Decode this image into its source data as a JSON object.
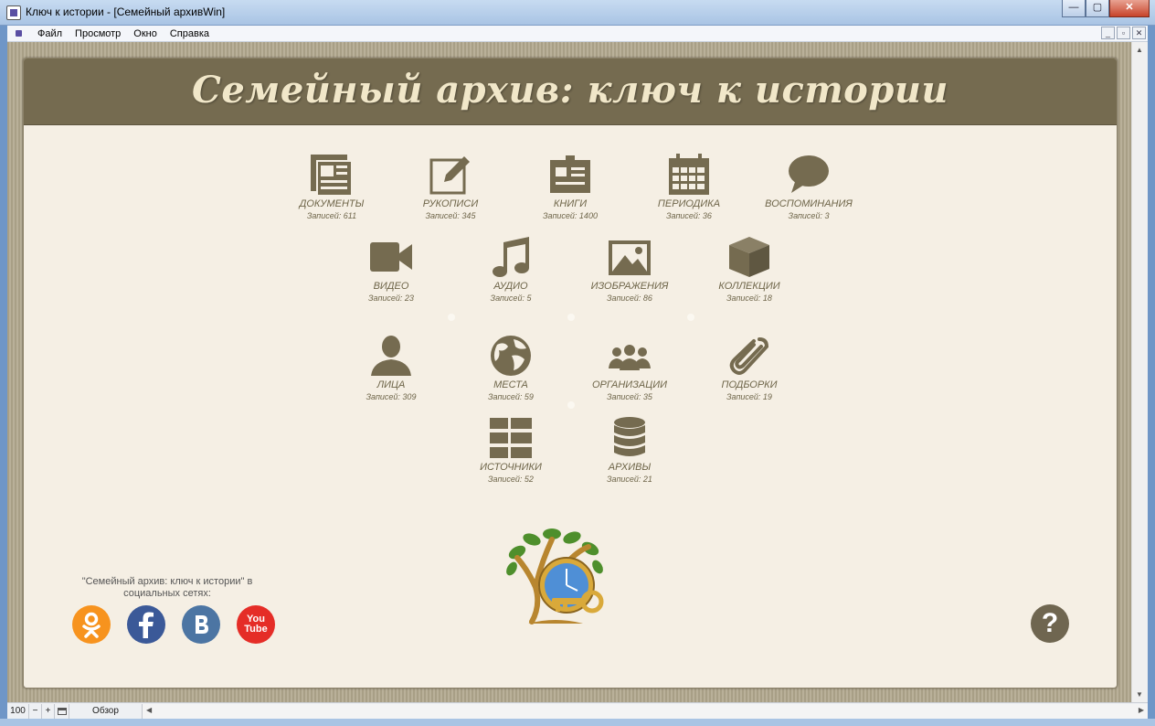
{
  "window": {
    "title": "Ключ к истории - [Семейный архивWin]",
    "minimize": "—",
    "maximize": "▢",
    "close": "✕"
  },
  "menu": {
    "items": [
      "Файл",
      "Просмотр",
      "Окно",
      "Справка"
    ],
    "mdi_minimize": "_",
    "mdi_restore": "▫",
    "mdi_close": "✕"
  },
  "header": {
    "title": "Семейный архив: ключ к истории"
  },
  "tiles": [
    {
      "label": "ДОКУМЕНТЫ",
      "count": "Записей: 611",
      "icon": "documents-icon"
    },
    {
      "label": "РУКОПИСИ",
      "count": "Записей: 345",
      "icon": "manuscripts-icon"
    },
    {
      "label": "КНИГИ",
      "count": "Записей: 1400",
      "icon": "books-icon"
    },
    {
      "label": "ПЕРИОДИКА",
      "count": "Записей: 36",
      "icon": "calendar-icon"
    },
    {
      "label": "ВОСПОМИНАНИЯ",
      "count": "Записей: 3",
      "icon": "speech-bubble-icon"
    },
    {
      "label": "ВИДЕО",
      "count": "Записей: 23",
      "icon": "video-camera-icon"
    },
    {
      "label": "АУДИО",
      "count": "Записей: 5",
      "icon": "music-note-icon"
    },
    {
      "label": "ИЗОБРАЖЕНИЯ",
      "count": "Записей: 86",
      "icon": "picture-icon"
    },
    {
      "label": "КОЛЛЕКЦИИ",
      "count": "Записей: 18",
      "icon": "box-icon"
    },
    {
      "label": "ЛИЦА",
      "count": "Записей: 309",
      "icon": "person-icon"
    },
    {
      "label": "МЕСТА",
      "count": "Записей: 59",
      "icon": "globe-icon"
    },
    {
      "label": "ОРГАНИЗАЦИИ",
      "count": "Записей: 35",
      "icon": "group-icon"
    },
    {
      "label": "ПОДБОРКИ",
      "count": "Записей: 19",
      "icon": "paperclip-icon"
    },
    {
      "label": "ИСТОЧНИКИ",
      "count": "Записей: 52",
      "icon": "grid-icon"
    },
    {
      "label": "АРХИВЫ",
      "count": "Записей: 21",
      "icon": "database-icon"
    }
  ],
  "social": {
    "caption": "\"Семейный архив: ключ к истории\" в социальных сетях:",
    "links": [
      {
        "name": "odnoklassniki",
        "color": "#f7931e"
      },
      {
        "name": "facebook",
        "color": "#3b5998"
      },
      {
        "name": "vkontakte",
        "color": "#4c75a3"
      },
      {
        "name": "youtube",
        "color": "#e52d27",
        "text_top": "You",
        "text_bottom": "Tube"
      }
    ]
  },
  "help": {
    "label": "?"
  },
  "statusbar": {
    "zoom": "100",
    "minus": "−",
    "plus": "+",
    "view": "Обзор"
  },
  "colors": {
    "header": "#756b50",
    "panel": "#f5efe4",
    "icon": "#756b50",
    "title": "#f1e7c9"
  }
}
